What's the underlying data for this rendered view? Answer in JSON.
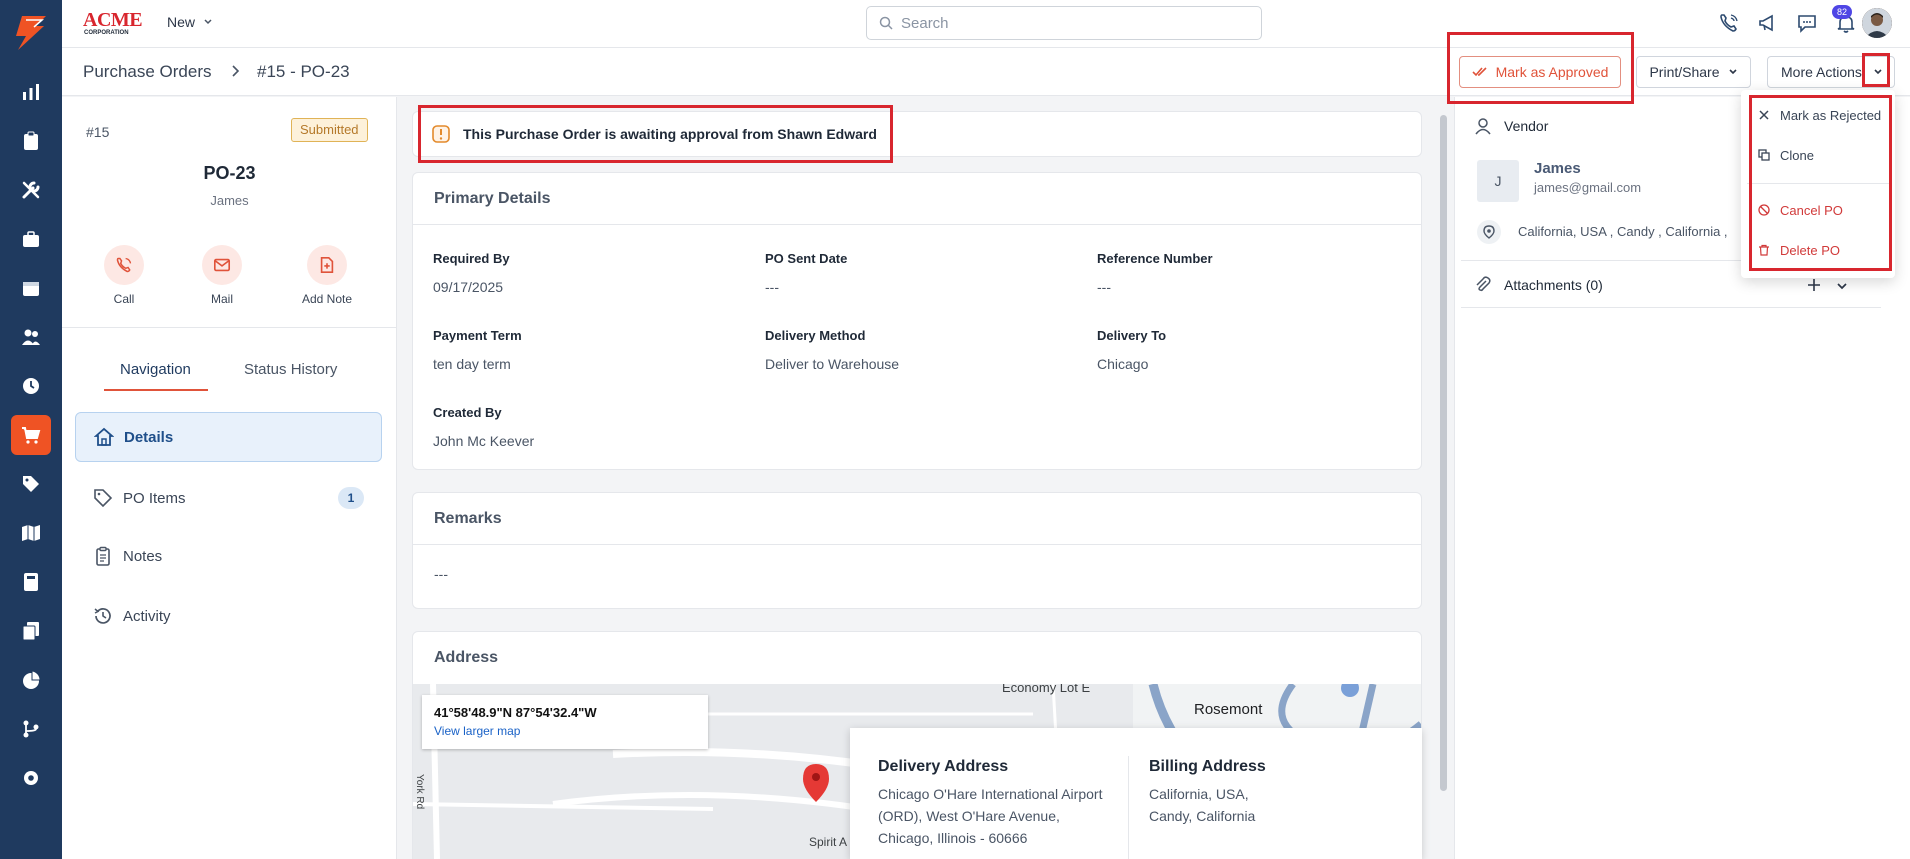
{
  "sidebar": {
    "items": [
      {
        "icon": "bar-chart-icon"
      },
      {
        "icon": "clipboard-icon"
      },
      {
        "icon": "wrench-icon"
      },
      {
        "icon": "briefcase-icon"
      },
      {
        "icon": "calendar-icon"
      },
      {
        "icon": "users-icon"
      },
      {
        "icon": "clock-icon"
      },
      {
        "icon": "cart-icon",
        "active": true
      },
      {
        "icon": "tag-icon"
      },
      {
        "icon": "map-icon"
      },
      {
        "icon": "calculator-icon"
      },
      {
        "icon": "documents-icon"
      },
      {
        "icon": "pie-chart-icon"
      },
      {
        "icon": "workflow-icon"
      },
      {
        "icon": "settings-icon"
      }
    ]
  },
  "topbar": {
    "brand_line1": "ACME",
    "brand_line2": "CORPORATION",
    "new_label": "New",
    "search_placeholder": "Search",
    "notification_count": "82"
  },
  "subbar": {
    "breadcrumb_parent": "Purchase Orders",
    "breadcrumb_current": "#15 - PO-23",
    "approve_label": "Mark as Approved",
    "print_label": "Print/Share",
    "more_label": "More Actions"
  },
  "po": {
    "number": "#15",
    "status": "Submitted",
    "title": "PO-23",
    "vendor": "James",
    "actions": [
      {
        "label": "Call",
        "icon": "phone-icon"
      },
      {
        "label": "Mail",
        "icon": "mail-icon"
      },
      {
        "label": "Add Note",
        "icon": "note-add-icon"
      }
    ]
  },
  "tabs": [
    {
      "label": "Navigation",
      "active": true
    },
    {
      "label": "Status History",
      "active": false
    }
  ],
  "nav": [
    {
      "label": "Details",
      "icon": "home-icon",
      "active": true
    },
    {
      "label": "PO Items",
      "icon": "tag-icon",
      "count": "1"
    },
    {
      "label": "Notes",
      "icon": "clipboard-icon"
    },
    {
      "label": "Activity",
      "icon": "history-icon"
    }
  ],
  "alert": {
    "text": "This Purchase Order is awaiting approval from Shawn Edward"
  },
  "primary": {
    "title": "Primary Details",
    "fields": [
      {
        "label": "Required By",
        "value": "09/17/2025"
      },
      {
        "label": "PO Sent Date",
        "value": "---"
      },
      {
        "label": "Reference Number",
        "value": "---"
      },
      {
        "label": "Payment Term",
        "value": "ten day term"
      },
      {
        "label": "Delivery Method",
        "value": "Deliver to Warehouse"
      },
      {
        "label": "Delivery To",
        "value": "Chicago"
      },
      {
        "label": "Created By",
        "value": "John Mc Keever"
      }
    ]
  },
  "remarks": {
    "title": "Remarks",
    "value": "---"
  },
  "address": {
    "title": "Address",
    "map_coord": "41°58'48.9\"N 87°54'32.4\"W",
    "map_link": "View larger map",
    "map_labels": {
      "economy_lot": "Economy Lot E",
      "rosemont": "Rosemont",
      "york_rd": "York Rd",
      "spirit": "Spirit A"
    },
    "delivery_title": "Delivery Address",
    "delivery_lines": [
      "Chicago O'Hare International Airport",
      "(ORD), West O'Hare Avenue,",
      "Chicago, Illinois - 60666"
    ],
    "billing_title": "Billing Address",
    "billing_lines": [
      "California, USA,",
      "Candy, California"
    ]
  },
  "vendor_panel": {
    "title": "Vendor",
    "avatar_letter": "J",
    "name": "James",
    "email": "james@gmail.com",
    "location": "California, USA , Candy , California ,",
    "attachments": "Attachments (0)"
  },
  "more_menu": [
    {
      "label": "Mark as Rejected",
      "icon": "close-icon"
    },
    {
      "label": "Clone",
      "icon": "clone-icon"
    },
    {
      "label": "Cancel PO",
      "icon": "ban-icon",
      "danger": true
    },
    {
      "label": "Delete PO",
      "icon": "trash-icon",
      "danger": true
    }
  ],
  "colors": {
    "sidebar": "#1f3a5f",
    "accent": "#ef5324",
    "highlight": "#d8262e",
    "link": "#1a62c7"
  }
}
